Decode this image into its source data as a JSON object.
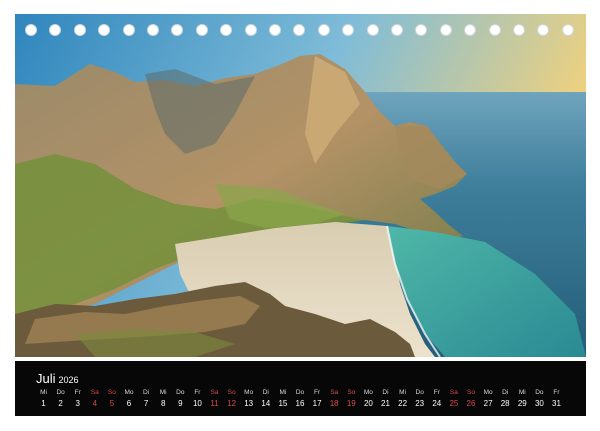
{
  "photo": {
    "subject": "mountain-beach-landscape",
    "colors": {
      "sky_top": "#3e95c6",
      "sky_horizon": "#f2d27c",
      "sea": "#2d6f8c",
      "lagoon": "#3fa9a0",
      "sand": "#e6dac3",
      "rock_sunlit": "#b69567",
      "grass": "#6f8f37"
    }
  },
  "binding": {
    "hole_count": 23
  },
  "calendar": {
    "month": "Juli",
    "year": "2026",
    "accent_weekend": "#d84a4a",
    "days": [
      {
        "wd": "Mi",
        "d": "1",
        "we": false
      },
      {
        "wd": "Do",
        "d": "2",
        "we": false
      },
      {
        "wd": "Fr",
        "d": "3",
        "we": false
      },
      {
        "wd": "Sa",
        "d": "4",
        "we": true
      },
      {
        "wd": "So",
        "d": "5",
        "we": true
      },
      {
        "wd": "Mo",
        "d": "6",
        "we": false
      },
      {
        "wd": "Di",
        "d": "7",
        "we": false
      },
      {
        "wd": "Mi",
        "d": "8",
        "we": false
      },
      {
        "wd": "Do",
        "d": "9",
        "we": false
      },
      {
        "wd": "Fr",
        "d": "10",
        "we": false
      },
      {
        "wd": "Sa",
        "d": "11",
        "we": true
      },
      {
        "wd": "So",
        "d": "12",
        "we": true
      },
      {
        "wd": "Mo",
        "d": "13",
        "we": false
      },
      {
        "wd": "Di",
        "d": "14",
        "we": false
      },
      {
        "wd": "Mi",
        "d": "15",
        "we": false
      },
      {
        "wd": "Do",
        "d": "16",
        "we": false
      },
      {
        "wd": "Fr",
        "d": "17",
        "we": false
      },
      {
        "wd": "Sa",
        "d": "18",
        "we": true
      },
      {
        "wd": "So",
        "d": "19",
        "we": true
      },
      {
        "wd": "Mo",
        "d": "20",
        "we": false
      },
      {
        "wd": "Di",
        "d": "21",
        "we": false
      },
      {
        "wd": "Mi",
        "d": "22",
        "we": false
      },
      {
        "wd": "Do",
        "d": "23",
        "we": false
      },
      {
        "wd": "Fr",
        "d": "24",
        "we": false
      },
      {
        "wd": "Sa",
        "d": "25",
        "we": true
      },
      {
        "wd": "So",
        "d": "26",
        "we": true
      },
      {
        "wd": "Mo",
        "d": "27",
        "we": false
      },
      {
        "wd": "Di",
        "d": "28",
        "we": false
      },
      {
        "wd": "Mi",
        "d": "29",
        "we": false
      },
      {
        "wd": "Do",
        "d": "30",
        "we": false
      },
      {
        "wd": "Fr",
        "d": "31",
        "we": false
      }
    ]
  }
}
